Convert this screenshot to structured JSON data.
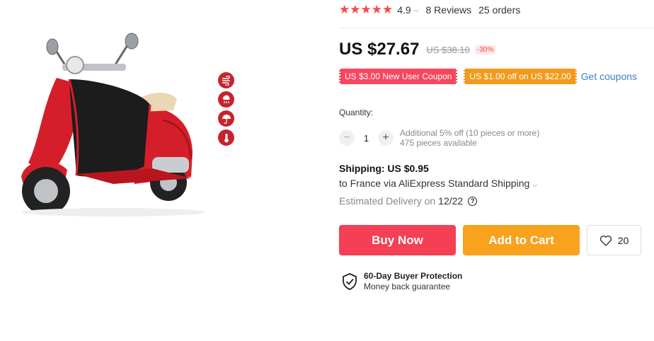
{
  "product": {
    "rating": "4.9",
    "reviews": "8 Reviews",
    "orders": "25 orders",
    "price": "US $27.67",
    "original_price": "US $38.10",
    "discount": "-30%"
  },
  "coupons": {
    "new_user": "US $3.00 New User Coupon",
    "store": "US $1.00 off on US $22.00",
    "get_link": "Get coupons"
  },
  "quantity": {
    "label": "Quantity:",
    "minus": "−",
    "value": "1",
    "plus": "+",
    "note_discount": "Additional 5% off (10 pieces or more)",
    "note_available": "475 pieces available"
  },
  "shipping": {
    "title": "Shipping: US $0.95",
    "destination": "to France via AliExpress Standard Shipping",
    "delivery_label": "Estimated Delivery on",
    "delivery_date": "12/22"
  },
  "actions": {
    "buy_now": "Buy Now",
    "add_to_cart": "Add to Cart",
    "wishlist_count": "20"
  },
  "protection": {
    "title": "60-Day Buyer Protection",
    "subtitle": "Money back guarantee"
  },
  "colors": {
    "star": "#f44",
    "buy": "#f43f55",
    "cart": "#f8a21d",
    "link": "#3a82c4",
    "scooter": "#d41f2a"
  },
  "icons": [
    "wind-icon",
    "rain-icon",
    "umbrella-icon",
    "thermometer-icon"
  ]
}
